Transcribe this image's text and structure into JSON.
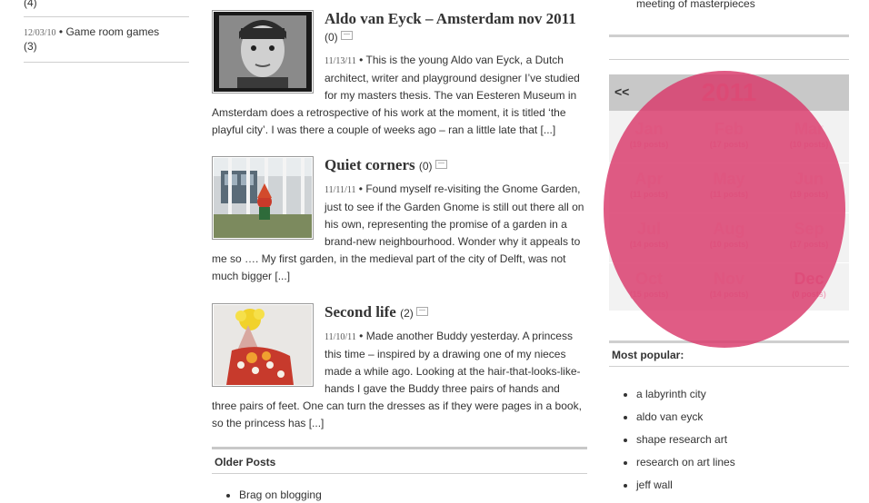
{
  "left": {
    "items": [
      {
        "count": "(4)"
      },
      {
        "date": "12/03/10",
        "title": "Game room games",
        "count": "(3)"
      }
    ]
  },
  "posts": [
    {
      "title": "Aldo van Eyck – Amsterdam nov 2011",
      "comments": "(0)",
      "date": "11/13/11",
      "excerpt": "This is the young Aldo van Eyck, a Dutch architect, writer and playground designer I’ve studied for my masters thesis. The van Eesteren Museum in Amsterdam does a retrospective of his work at the moment, it is titled ‘the playful city’. I was there a couple of weeks ago – ran a little late that [...]"
    },
    {
      "title": "Quiet corners",
      "comments": "(0)",
      "date": "11/11/11",
      "excerpt": "Found myself re-visiting the Gnome Garden, just to see if  the Garden Gnome is still out there all on his own, representing the promise of a garden in a brand-new neighbourhood. Wonder why it appeals to me so …. My first garden, in the medieval part of the city of Delft, was not much bigger [...]"
    },
    {
      "title": "Second life",
      "comments": "(2)",
      "date": "11/10/11",
      "excerpt": "Made another Buddy yesterday. A princess this time – inspired by a drawing one of my nieces made a while ago. Looking at the hair-that-looks-like-hands I gave the Buddy three pairs of hands and three pairs of feet. One can turn the dresses as if they were pages in a book, so the princess has [...]"
    }
  ],
  "older": {
    "heading": "Older Posts",
    "items": [
      "Brag on blogging"
    ]
  },
  "sidebar": {
    "top_text": "meeting of masterpieces",
    "calendar": {
      "prev": "<<",
      "year": "2011",
      "months": [
        {
          "name": "Jan",
          "posts": "(19 posts)",
          "active": true
        },
        {
          "name": "Feb",
          "posts": "(17 posts)",
          "active": true
        },
        {
          "name": "Mar",
          "posts": "(10 posts)",
          "active": true
        },
        {
          "name": "Apr",
          "posts": "(11 posts)",
          "active": true
        },
        {
          "name": "May",
          "posts": "(11 posts)",
          "active": true
        },
        {
          "name": "Jun",
          "posts": "(19 posts)",
          "active": true
        },
        {
          "name": "Jul",
          "posts": "(14 posts)",
          "active": true
        },
        {
          "name": "Aug",
          "posts": "(10 posts)",
          "active": true
        },
        {
          "name": "Sep",
          "posts": "(17 posts)",
          "active": true
        },
        {
          "name": "Oct",
          "posts": "(15 posts)",
          "active": true
        },
        {
          "name": "Nov",
          "posts": "(14 posts)",
          "active": true
        },
        {
          "name": "Dec",
          "posts": "(0 posts)",
          "active": false
        }
      ]
    },
    "popular": {
      "heading": "Most popular:",
      "items": [
        "a labyrinth city",
        "aldo van eyck",
        "shape research art",
        "research on art lines",
        "jeff wall"
      ]
    }
  },
  "colors": {
    "highlight_circle": "#d9386a",
    "calendar_header": "#c8c8c8",
    "year_text": "#e89aa8"
  }
}
